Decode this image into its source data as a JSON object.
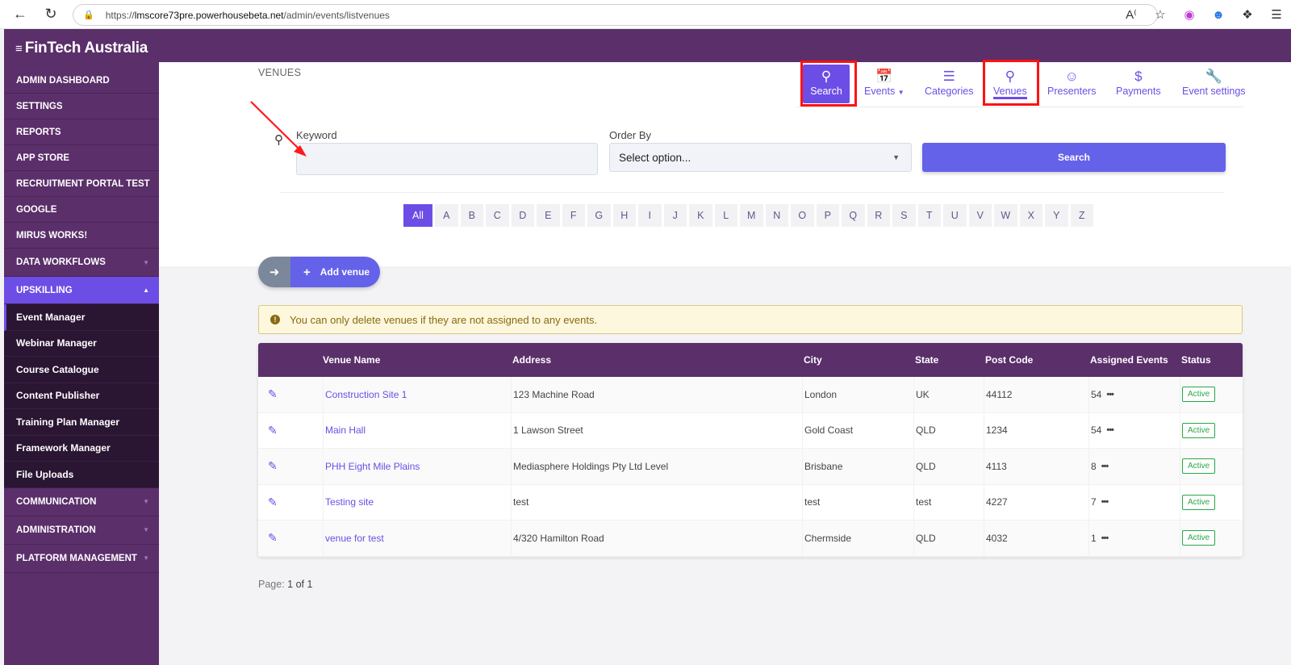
{
  "browser": {
    "url_prefix": "https://",
    "url_host": "lmscore73pre.powerhousebeta.net",
    "url_path": "/admin/events/listvenues",
    "icons": [
      "back-icon",
      "refresh-icon",
      "lock-icon",
      "read-aloud-icon",
      "favorite-icon",
      "extension-icon",
      "profile-icon",
      "puzzle-icon",
      "favorites-bar-icon"
    ]
  },
  "sidebar": {
    "logo": "FinTech Australia",
    "items": [
      {
        "label": "ADMIN DASHBOARD"
      },
      {
        "label": "SETTINGS"
      },
      {
        "label": "REPORTS"
      },
      {
        "label": "APP STORE"
      },
      {
        "label": "RECRUITMENT PORTAL TEST"
      },
      {
        "label": "GOOGLE"
      },
      {
        "label": "MIRUS WORKS!"
      },
      {
        "label": "DATA WORKFLOWS"
      },
      {
        "label": "UPSKILLING"
      }
    ],
    "sub_items": [
      {
        "label": "Event Manager"
      },
      {
        "label": "Webinar Manager"
      },
      {
        "label": "Course Catalogue"
      },
      {
        "label": "Content Publisher"
      },
      {
        "label": "Training Plan Manager"
      },
      {
        "label": "Framework Manager"
      },
      {
        "label": "File Uploads"
      }
    ],
    "bottom_items": [
      {
        "label": "COMMUNICATION"
      },
      {
        "label": "ADMINISTRATION"
      },
      {
        "label": "PLATFORM MANAGEMENT"
      }
    ]
  },
  "page": {
    "title": "VENUES",
    "tabs": [
      {
        "label": "Search",
        "icon": "search-icon"
      },
      {
        "label": "Events",
        "icon": "calendar-icon"
      },
      {
        "label": "Categories",
        "icon": "categories-icon"
      },
      {
        "label": "Venues",
        "icon": "location-pin-icon"
      },
      {
        "label": "Presenters",
        "icon": "person-icon"
      },
      {
        "label": "Payments",
        "icon": "dollar-icon"
      },
      {
        "label": "Event settings",
        "icon": "wrench-icon"
      }
    ]
  },
  "filters": {
    "keyword_label": "Keyword",
    "keyword_value": "",
    "order_label": "Order By",
    "order_selected": "Select option...",
    "search_button": "Search"
  },
  "alphabet": [
    "All",
    "A",
    "B",
    "C",
    "D",
    "E",
    "F",
    "G",
    "H",
    "I",
    "J",
    "K",
    "L",
    "M",
    "N",
    "O",
    "P",
    "Q",
    "R",
    "S",
    "T",
    "U",
    "V",
    "W",
    "X",
    "Y",
    "Z"
  ],
  "actions": {
    "add_venue": "Add venue"
  },
  "warning": "You can only delete venues if they are not assigned to any events.",
  "table": {
    "headers": [
      "Venue Name",
      "Address",
      "City",
      "State",
      "Post Code",
      "Assigned Events",
      "Status"
    ],
    "rows": [
      {
        "name": "Construction Site 1",
        "address": "123 Machine Road",
        "city": "London",
        "state": "UK",
        "postcode": "44112",
        "events": "54",
        "status": "Active"
      },
      {
        "name": "Main Hall",
        "address": "1 Lawson Street",
        "city": "Gold Coast",
        "state": "QLD",
        "postcode": "1234",
        "events": "54",
        "status": "Active"
      },
      {
        "name": "PHH Eight Mile Plains",
        "address": "Mediasphere Holdings Pty Ltd Level",
        "city": "Brisbane",
        "state": "QLD",
        "postcode": "4113",
        "events": "8",
        "status": "Active"
      },
      {
        "name": "Testing site",
        "address": "test",
        "city": "test",
        "state": "test",
        "postcode": "4227",
        "events": "7",
        "status": "Active"
      },
      {
        "name": "venue for test",
        "address": "4/320 Hamilton Road",
        "city": "Chermside",
        "state": "QLD",
        "postcode": "4032",
        "events": "1",
        "status": "Active"
      }
    ]
  },
  "pager": {
    "label": "Page:",
    "value": "1 of 1"
  },
  "colors": {
    "brand_purple": "#5a2f6a",
    "accent": "#6c4ee6",
    "highlight": "#ff1212",
    "active_green": "#28a745"
  }
}
